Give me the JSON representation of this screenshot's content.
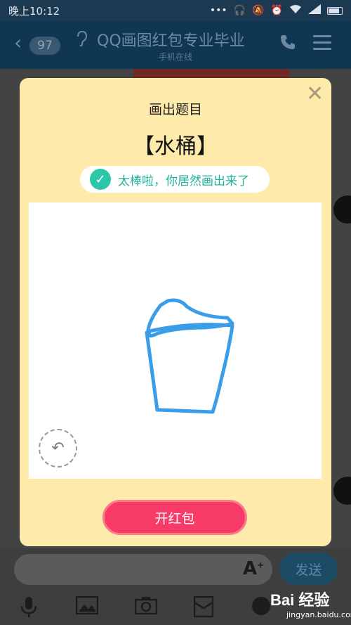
{
  "status_bar": {
    "time": "晚上10:12",
    "icons": [
      "more-icon",
      "headset-icon",
      "mute-icon",
      "alarm-icon",
      "wifi-icon",
      "signal-icon",
      "battery-icon"
    ]
  },
  "header": {
    "back_count": "97",
    "title": "QQ画图红包专业毕业",
    "subtitle": "手机在线"
  },
  "modal": {
    "title": "画出题目",
    "word": "【水桶】",
    "success_text": "太棒啦，你居然画出来了",
    "open_button": "开红包",
    "accent_color": "#f83a66",
    "success_color": "#2cc7a8",
    "stroke_color": "#3a9de8"
  },
  "input": {
    "send_label": "发送"
  },
  "watermark": {
    "brand": "Bai 经验",
    "site": "jingyan.baidu.com"
  }
}
